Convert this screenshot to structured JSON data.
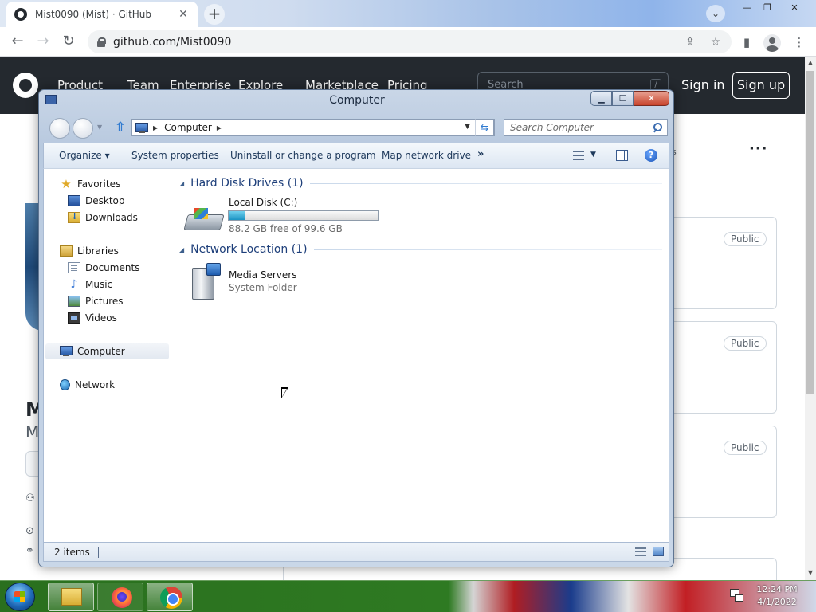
{
  "browser": {
    "tab_title": "Mist0090 (Mist) · GitHub",
    "tab_close": "✕",
    "new_tab": "+",
    "url": "github.com/Mist0090",
    "window_controls": {
      "minimize": "—",
      "restore": "❐",
      "close": "✕"
    }
  },
  "github": {
    "nav": [
      "Product",
      "Team",
      "Enterprise",
      "Explore",
      "Marketplace",
      "Pricing"
    ],
    "search_placeholder": "Search",
    "search_key": "/",
    "sign_in": "Sign in",
    "sign_up": "Sign up",
    "more": "···",
    "name_fragment": "M",
    "username_fragment": "M",
    "repo_badges": [
      "Public",
      "Public",
      "Public"
    ]
  },
  "explorer": {
    "title": "Computer",
    "breadcrumb": "Computer",
    "search_placeholder": "Search Computer",
    "command_bar": {
      "organize": "Organize ▾",
      "system_properties": "System properties",
      "uninstall": "Uninstall or change a program",
      "map_drive": "Map network drive",
      "more": "»"
    },
    "nav_pane": {
      "favorites": "Favorites",
      "desktop": "Desktop",
      "downloads": "Downloads",
      "libraries": "Libraries",
      "documents": "Documents",
      "music": "Music",
      "pictures": "Pictures",
      "videos": "Videos",
      "computer": "Computer",
      "network": "Network"
    },
    "groups": {
      "hard_disk": "Hard Disk Drives (1)",
      "network_location": "Network Location (1)"
    },
    "drive": {
      "name": "Local Disk (C:)",
      "free_text": "88.2 GB free of 99.6 GB",
      "used_fraction": 0.114
    },
    "network_item": {
      "name": "Media Servers",
      "type": "System Folder"
    },
    "status": {
      "item_count": "2 items"
    },
    "icons": [
      "computer-icon",
      "search-icon",
      "up-arrow-icon",
      "refresh-icon",
      "help-icon",
      "view-icon",
      "preview-pane-icon"
    ]
  },
  "taskbar": {
    "time": "12:24 PM",
    "date": "4/1/2022"
  }
}
